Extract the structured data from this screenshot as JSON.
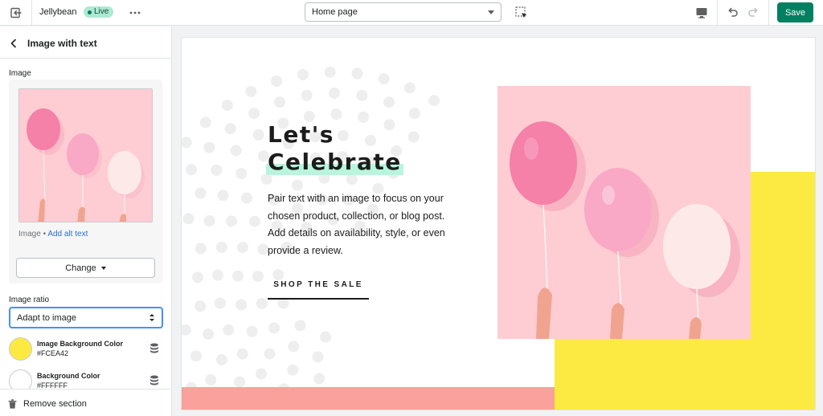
{
  "topbar": {
    "theme_name": "Jellybean",
    "status_badge": "Live",
    "page_selector": {
      "selected": "Home page"
    },
    "save_label": "Save"
  },
  "sidebar": {
    "title": "Image with text",
    "image_label": "Image",
    "image_caption_prefix": "Image •",
    "alt_text_link": "Add alt text",
    "change_label": "Change",
    "image_ratio_label": "Image ratio",
    "image_ratio_value": "Adapt to image",
    "colors": [
      {
        "name": "Image Background Color",
        "hex": "#FCEA42"
      },
      {
        "name": "Background Color",
        "hex": "#FFFFFF"
      }
    ],
    "remove_label": "Remove section"
  },
  "preview": {
    "title_line1": "Let's",
    "title_line2": "Celebrate",
    "body": "Pair text with an image to focus on your chosen product, collection, or blog post. Add details on availability, style, or even provide a review.",
    "cta": "SHOP THE SALE",
    "colors": {
      "yellow": "#FCEA42",
      "pink_strip": "#F9A19A",
      "highlight": "#B9F5DC",
      "image_bg": "#FECDD3",
      "dots": "#EEEEEE"
    }
  },
  "icons": [
    "exit-icon",
    "more-icon",
    "select-element-icon",
    "desktop-icon",
    "undo-icon",
    "redo-icon",
    "back-icon",
    "database-icon",
    "trash-icon"
  ]
}
